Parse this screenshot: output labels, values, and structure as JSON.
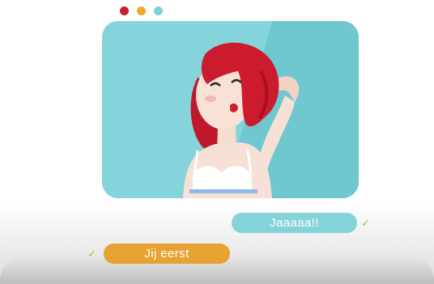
{
  "chat": {
    "incoming_message": "Jaaaaa!!",
    "outgoing_message": "Jij eerst"
  },
  "icons": {
    "read_check": "checkmark-icon"
  },
  "colors": {
    "dot_red": "#c8202e",
    "dot_yellow": "#f0a92f",
    "dot_blue": "#7dd1d9",
    "video_background": "#86d4db",
    "incoming_bubble": "#85d3da",
    "outgoing_bubble": "#e7a232",
    "check_green": "#8cc63f"
  }
}
